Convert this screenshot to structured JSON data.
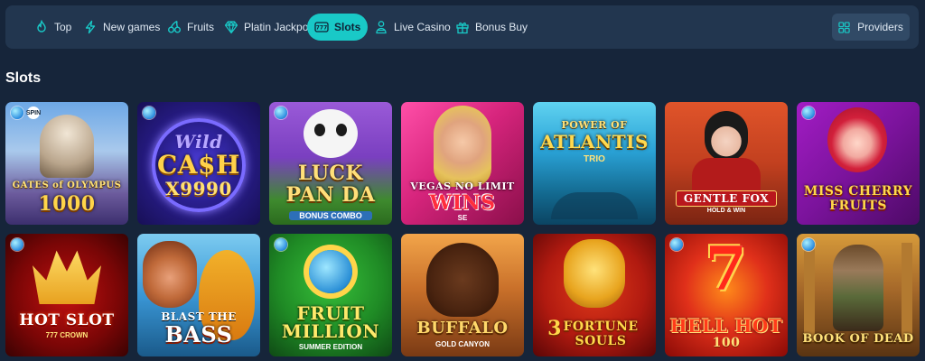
{
  "nav": {
    "items": [
      {
        "label": "Top",
        "icon": "flame-icon"
      },
      {
        "label": "New games",
        "icon": "lightning-icon"
      },
      {
        "label": "Fruits",
        "icon": "cherries-icon"
      },
      {
        "label": "Platin Jackpots",
        "icon": "diamond-icon"
      },
      {
        "label": "Slots",
        "icon": "slot-777-icon",
        "active": true
      },
      {
        "label": "Live Casino",
        "icon": "dealer-icon"
      },
      {
        "label": "Bonus Buy",
        "icon": "gift-icon"
      }
    ],
    "providers_label": "Providers",
    "accent": "#19c9c7"
  },
  "section": {
    "title": "Slots"
  },
  "games": [
    {
      "line1": "GATES of OLYMPUS",
      "line2": "1000"
    },
    {
      "line1": "Wild",
      "line2": "CA$H",
      "line3": "X9990"
    },
    {
      "line1": "LUCK",
      "line2": "PAN DA",
      "line3": "BONUS COMBO"
    },
    {
      "line1": "VEGAS NO LIMIT",
      "line2": "WINS",
      "line3": "SE"
    },
    {
      "line1": "POWER OF",
      "line2": "ATLANTIS",
      "line3": "TRIO"
    },
    {
      "line1": "GENTLE FOX",
      "line2": "HOLD & WIN"
    },
    {
      "line1": "MISS CHERRY",
      "line2": "FRUITS"
    },
    {
      "line1": "HOT SLOT",
      "line2": "777 CROWN"
    },
    {
      "line1": "BLAST THE",
      "line2": "BASS"
    },
    {
      "line1": "FRUIT",
      "line2": "MILLION",
      "line3": "SUMMER EDITION"
    },
    {
      "line1": "BUFFALO",
      "line2": "GOLD CANYON"
    },
    {
      "line1": "3",
      "line2": "FORTUNE",
      "line3": "SOULS"
    },
    {
      "line1": "HELL HOT",
      "line2": "100"
    },
    {
      "line1": "BOOK OF DEAD"
    }
  ],
  "badge_text": "SPIN"
}
